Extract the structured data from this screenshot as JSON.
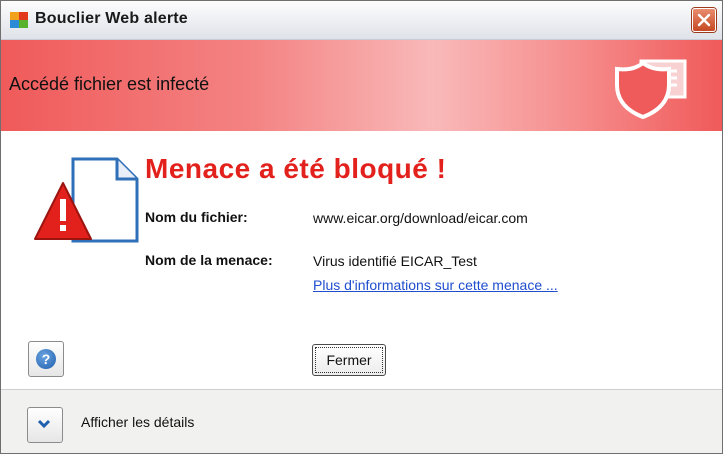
{
  "window": {
    "title": "Bouclier Web alerte"
  },
  "banner": {
    "text": "Accédé fichier est infecté"
  },
  "main": {
    "headline": "Menace a été bloqué !",
    "file_label": "Nom du fichier:",
    "file_value": "www.eicar.org/download/eicar.com",
    "threat_label": "Nom de la menace:",
    "threat_value": "Virus identifié EICAR_Test",
    "more_info_link": "Plus d'informations sur cette menace ..."
  },
  "buttons": {
    "help_glyph": "?",
    "close_label": "Fermer"
  },
  "footer": {
    "details_label": "Afficher les détails"
  },
  "colors": {
    "headline": "#e3211c",
    "banner": "#f05a5a",
    "link": "#1f4ecf"
  },
  "icons": [
    "app-icon",
    "close-icon",
    "shield-icon",
    "alert-icon",
    "help-icon",
    "chevron-down-icon"
  ]
}
